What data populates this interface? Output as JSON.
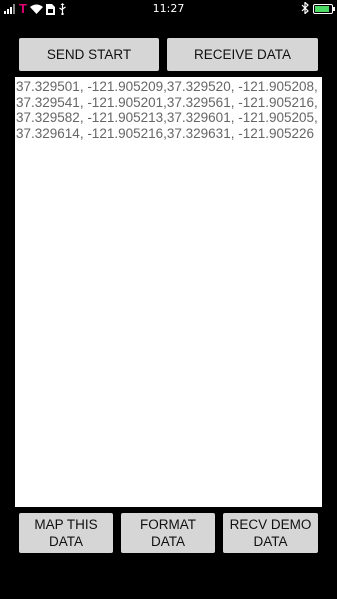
{
  "status_bar": {
    "time": "11:27",
    "carrier_logo": "T",
    "battery_color": "#4cd964",
    "battery_level": 0.85,
    "icons": [
      "signal-icon",
      "carrier-logo",
      "wifi-icon",
      "sim-icon",
      "usb-icon",
      "bluetooth-icon",
      "battery-icon"
    ]
  },
  "buttons": {
    "send_start": "SEND START",
    "receive_data": "RECEIVE DATA",
    "map_this_data": "MAP THIS DATA",
    "format_data": "FORMAT DATA",
    "recv_demo_data": "RECV DEMO DATA"
  },
  "data_area": {
    "text": "37.329501, -121.905209,37.329520, -121.905208,37.329541, -121.905201,37.329561, -121.905216,37.329582, -121.905213,37.329601, -121.905205,37.329614, -121.905216,37.329631, -121.905226"
  }
}
